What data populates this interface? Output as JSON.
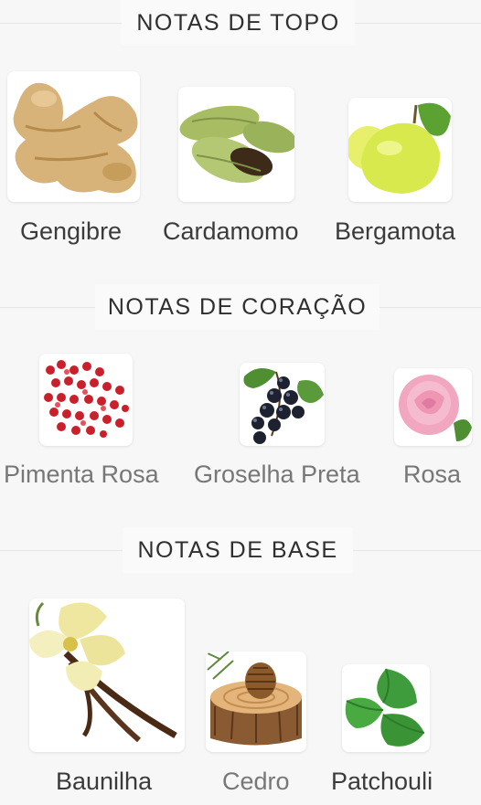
{
  "sections": [
    {
      "title": "NOTAS DE TOPO",
      "notes": [
        {
          "label": "Gengibre",
          "icon": "ginger-image"
        },
        {
          "label": "Cardamomo",
          "icon": "cardamom-image"
        },
        {
          "label": "Bergamota",
          "icon": "bergamot-image"
        }
      ]
    },
    {
      "title": "NOTAS DE CORAÇÃO",
      "notes": [
        {
          "label": "Pimenta Rosa",
          "icon": "pink-pepper-image"
        },
        {
          "label": "Groselha Preta",
          "icon": "blackcurrant-image"
        },
        {
          "label": "Rosa",
          "icon": "rose-image"
        }
      ]
    },
    {
      "title": "NOTAS DE BASE",
      "notes": [
        {
          "label": "Baunilha",
          "icon": "vanilla-image"
        },
        {
          "label": "Cedro",
          "icon": "cedar-image"
        },
        {
          "label": "Patchouli",
          "icon": "patchouli-image"
        }
      ]
    }
  ],
  "colors": {
    "background": "#f7f7f7",
    "text": "#3a3a3a",
    "label_muted": "#777777"
  }
}
